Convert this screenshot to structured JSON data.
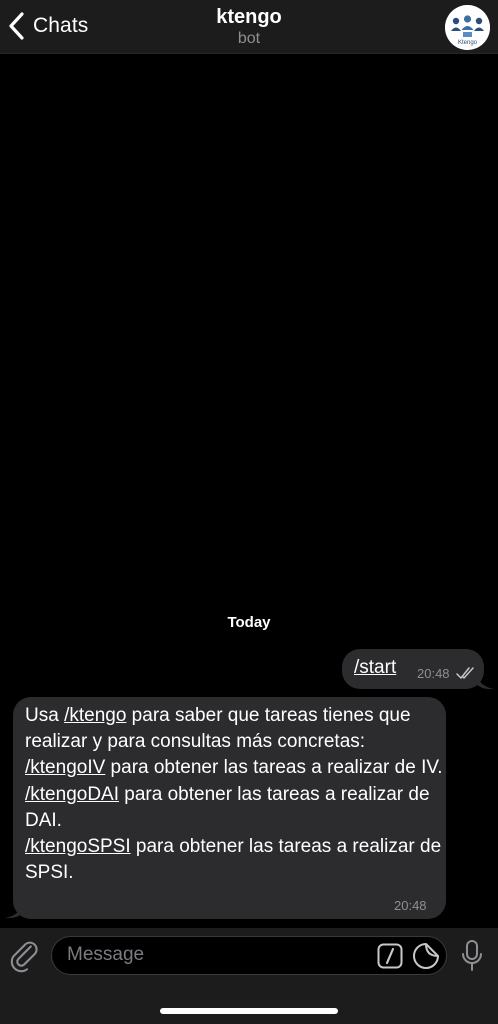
{
  "header": {
    "back_label": "Chats",
    "title": "ktengo",
    "subtitle": "bot",
    "avatar_text": "Ktengo"
  },
  "date_label": "Today",
  "messages": {
    "outgoing": {
      "text": "/start",
      "time": "20:48",
      "status_icon": "double-check-icon"
    },
    "incoming": {
      "intro_prefix": "Usa ",
      "intro_cmd": "/ktengo",
      "intro_suffix": " para saber que tareas tienes que realizar y para consultas más concretas:",
      "line1_cmd": "/ktengoIV",
      "line1_text": " para obtener las tareas a realizar de IV.",
      "line2_cmd": "/ktengoDAI",
      "line2_text": " para obtener las tareas a realizar de DAI.",
      "line3_cmd": "/ktengoSPSI",
      "line3_text": " para obtener las tareas a realizar de SPSI.",
      "time": "20:48"
    }
  },
  "composer": {
    "placeholder": "Message",
    "icons": [
      "paperclip-icon",
      "bot-command-icon",
      "sticker-icon",
      "microphone-icon"
    ]
  },
  "colors": {
    "background": "#000000",
    "header_bg": "#1c1c1d",
    "bubble_bg": "#2c2c2e",
    "secondary_text": "#8e8e93",
    "accent": "#ffffff"
  }
}
